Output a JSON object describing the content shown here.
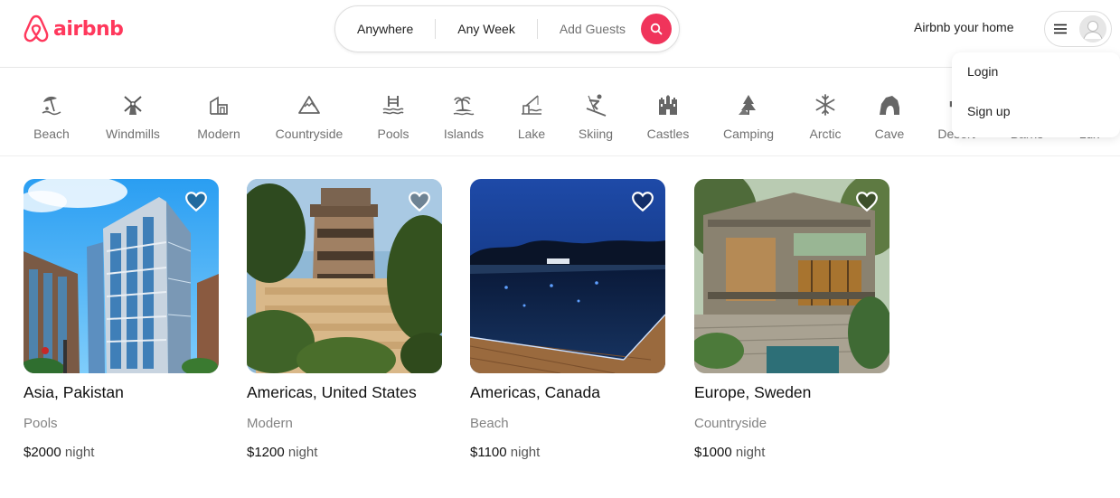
{
  "brand": {
    "name": "airbnb",
    "color": "#ff385c"
  },
  "search": {
    "where": "Anywhere",
    "when": "Any Week",
    "who": "Add Guests",
    "button_icon": "search-icon"
  },
  "header": {
    "host_link": "Airbnb your home",
    "menu_icon": "hamburger-icon",
    "avatar_icon": "user-avatar-icon"
  },
  "user_dropdown": {
    "items": [
      "Login",
      "Sign up"
    ]
  },
  "categories": [
    {
      "label": "Beach",
      "icon": "beach-umbrella-icon"
    },
    {
      "label": "Windmills",
      "icon": "windmill-icon"
    },
    {
      "label": "Modern",
      "icon": "modern-house-icon"
    },
    {
      "label": "Countryside",
      "icon": "mountain-icon"
    },
    {
      "label": "Pools",
      "icon": "pool-icon"
    },
    {
      "label": "Islands",
      "icon": "island-icon"
    },
    {
      "label": "Lake",
      "icon": "lake-icon"
    },
    {
      "label": "Skiing",
      "icon": "skiing-icon"
    },
    {
      "label": "Castles",
      "icon": "castle-icon"
    },
    {
      "label": "Camping",
      "icon": "camping-icon"
    },
    {
      "label": "Arctic",
      "icon": "snowflake-icon"
    },
    {
      "label": "Cave",
      "icon": "cave-icon"
    },
    {
      "label": "Desert",
      "icon": "desert-icon"
    },
    {
      "label": "Barns",
      "icon": "barn-icon"
    },
    {
      "label": "Lux",
      "icon": "lux-icon"
    }
  ],
  "listings": [
    {
      "location": "Asia, Pakistan",
      "category": "Pools",
      "price": "$2000",
      "unit": "night"
    },
    {
      "location": "Americas, United States",
      "category": "Modern",
      "price": "$1200",
      "unit": "night"
    },
    {
      "location": "Americas, Canada",
      "category": "Beach",
      "price": "$1100",
      "unit": "night"
    },
    {
      "location": "Europe, Sweden",
      "category": "Countryside",
      "price": "$1000",
      "unit": "night"
    }
  ]
}
